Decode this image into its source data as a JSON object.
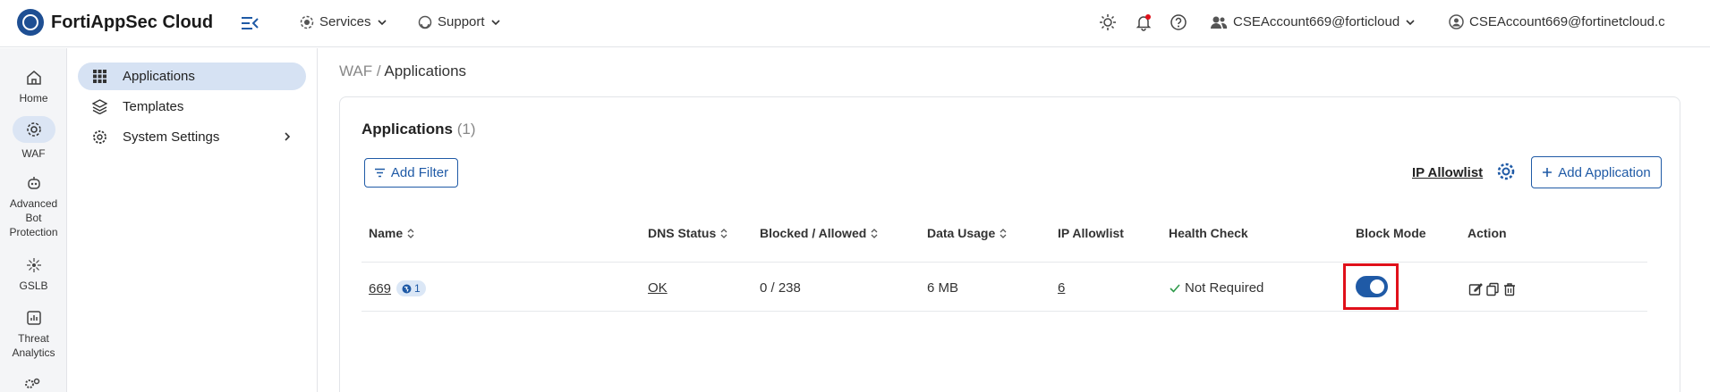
{
  "app": {
    "title": "FortiAppSec Cloud"
  },
  "topnav": {
    "services_label": "Services",
    "support_label": "Support",
    "account1": "CSEAccount669@forticloud",
    "account2": "CSEAccount669@fortinetcloud.c"
  },
  "rail": {
    "items": [
      {
        "label": "Home",
        "icon": "home-icon"
      },
      {
        "label": "WAF",
        "icon": "waf-icon"
      },
      {
        "label": "Advanced Bot Protection",
        "icon": "bot-icon"
      },
      {
        "label": "GSLB",
        "icon": "gslb-icon"
      },
      {
        "label": "Threat Analytics",
        "icon": "analytics-icon"
      }
    ]
  },
  "sidebar": {
    "items": [
      {
        "label": "Applications",
        "icon": "grid-icon"
      },
      {
        "label": "Templates",
        "icon": "layers-icon"
      },
      {
        "label": "System Settings",
        "icon": "gear-icon"
      }
    ]
  },
  "breadcrumb": {
    "parent": "WAF",
    "sep": " / ",
    "current": "Applications"
  },
  "card": {
    "title": "Applications",
    "count": "(1)",
    "add_filter": "Add Filter",
    "ip_allowlist_link": "IP Allowlist",
    "add_application": "Add Application"
  },
  "table": {
    "columns": [
      "Name",
      "DNS Status",
      "Blocked / Allowed",
      "Data Usage",
      "IP Allowlist",
      "Health Check",
      "Block Mode",
      "Action"
    ],
    "row": {
      "name": "669",
      "badge": "1",
      "dns_status": "OK",
      "blocked_allowed": "0 / 238",
      "data_usage": "6 MB",
      "ip_allowlist": "6",
      "health_check": "Not Required",
      "block_mode": true
    }
  },
  "colors": {
    "accent": "#1f5aa6",
    "highlight": "#e0101a"
  }
}
